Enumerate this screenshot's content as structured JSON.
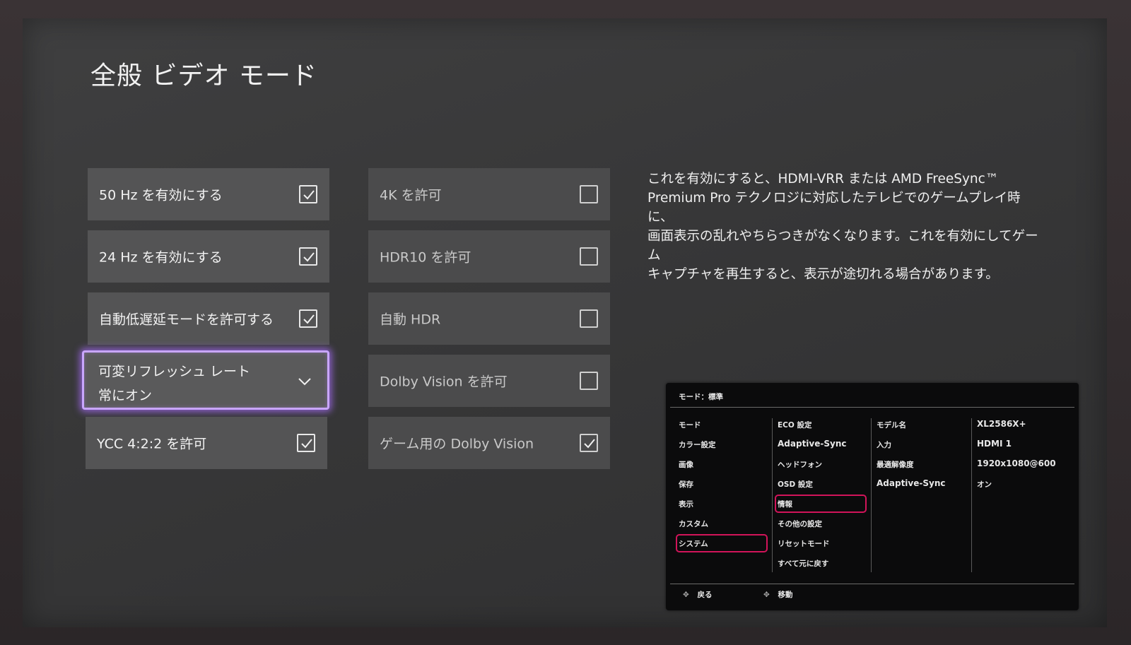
{
  "page": {
    "title": "全般 ビデオ モード"
  },
  "left_column": [
    {
      "label": "50 Hz を有効にする",
      "checked": true
    },
    {
      "label": "24 Hz を有効にする",
      "checked": true
    },
    {
      "label": "自動低遅延モードを許可する",
      "checked": true
    },
    {
      "label": "可変リフレッシュ レート",
      "value": "常にオン",
      "type": "dropdown",
      "focused": true
    },
    {
      "label": "YCC 4:2:2 を許可",
      "checked": true
    }
  ],
  "right_column": [
    {
      "label": "4K を許可",
      "checked": false
    },
    {
      "label": "HDR10 を許可",
      "checked": false
    },
    {
      "label": "自動 HDR",
      "checked": false
    },
    {
      "label": "Dolby Vision を許可",
      "checked": false
    },
    {
      "label": "ゲーム用の Dolby Vision",
      "checked": true
    }
  ],
  "description": {
    "lines": [
      "これを有効にすると、HDMI-VRR または AMD FreeSync™",
      "Premium Pro テクノロジに対応したテレビでのゲームプレイ時に、",
      "画面表示の乱れやちらつきがなくなります。これを有効にしてゲーム",
      "キャプチャを再生すると、表示が途切れる場合があります。"
    ]
  },
  "osd": {
    "header": "モード：標準",
    "menu": [
      "モード",
      "カラー設定",
      "画像",
      "保存",
      "表示",
      "カスタム",
      "システム"
    ],
    "selected_menu": "システム",
    "submenu": [
      "ECO 設定",
      "Adaptive-Sync",
      "ヘッドフォン",
      "OSD 設定",
      "情報",
      "その他の設定",
      "リセットモード",
      "すべて元に戻す"
    ],
    "selected_submenu": "情報",
    "info_labels": [
      "モデル名",
      "入力",
      "最適解像度",
      "Adaptive-Sync"
    ],
    "info_values": [
      "XL2586X+",
      "HDMI 1",
      "1920x1080@600",
      "オン"
    ],
    "footer": {
      "back": "戻る",
      "move": "移動"
    }
  },
  "colors": {
    "focus_glow": "#b57cff",
    "osd_highlight": "#d2145a",
    "tile_bg": "#545455"
  }
}
